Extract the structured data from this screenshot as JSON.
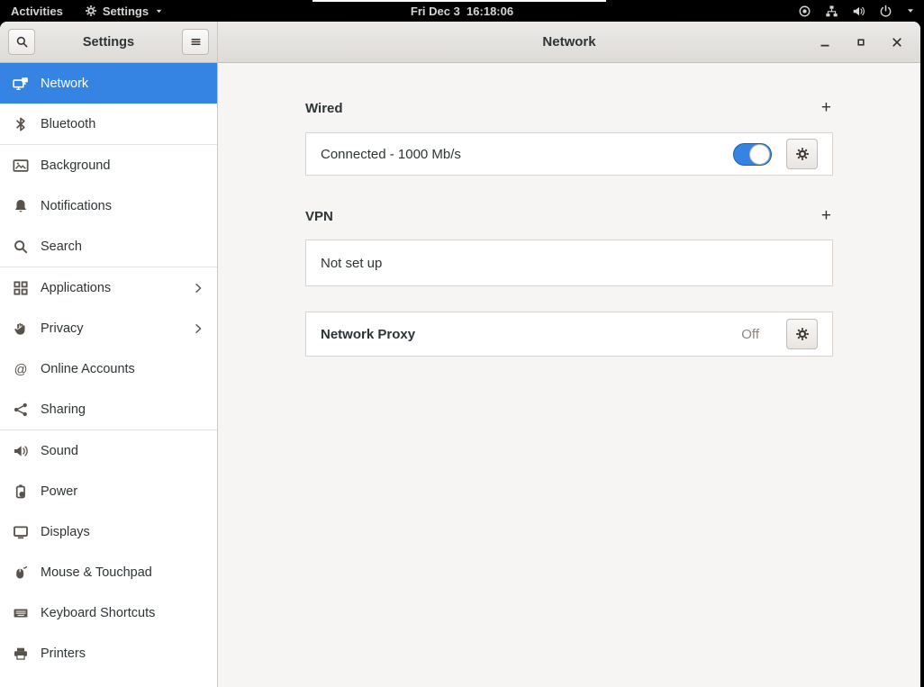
{
  "top_bar": {
    "activities_label": "Activities",
    "app_menu_label": "Settings",
    "clock": "Fri Dec 3  16:18:06"
  },
  "sidebar": {
    "title": "Settings",
    "groups": [
      {
        "items": [
          {
            "label": "Network",
            "icon": "network-icon",
            "selected": true
          },
          {
            "label": "Bluetooth",
            "icon": "bluetooth-icon"
          }
        ]
      },
      {
        "items": [
          {
            "label": "Background",
            "icon": "background-icon"
          },
          {
            "label": "Notifications",
            "icon": "notifications-icon"
          },
          {
            "label": "Search",
            "icon": "search-icon"
          }
        ]
      },
      {
        "items": [
          {
            "label": "Applications",
            "icon": "applications-icon",
            "chevron": true
          },
          {
            "label": "Privacy",
            "icon": "privacy-icon",
            "chevron": true
          },
          {
            "label": "Online Accounts",
            "icon": "online-accounts-icon"
          },
          {
            "label": "Sharing",
            "icon": "sharing-icon"
          }
        ]
      },
      {
        "items": [
          {
            "label": "Sound",
            "icon": "sound-icon"
          },
          {
            "label": "Power",
            "icon": "power-icon"
          },
          {
            "label": "Displays",
            "icon": "displays-icon"
          },
          {
            "label": "Mouse & Touchpad",
            "icon": "mouse-icon"
          },
          {
            "label": "Keyboard Shortcuts",
            "icon": "keyboard-icon"
          },
          {
            "label": "Printers",
            "icon": "printer-icon"
          }
        ]
      }
    ]
  },
  "header": {
    "title": "Network"
  },
  "content": {
    "wired": {
      "title": "Wired",
      "add_label": "+",
      "row_label": "Connected - 1000 Mb/s",
      "toggle_on": true
    },
    "vpn": {
      "title": "VPN",
      "add_label": "+",
      "row_label": "Not set up"
    },
    "proxy": {
      "title": "Network Proxy",
      "status": "Off"
    }
  },
  "colors": {
    "accent": "#3584e4",
    "topbar_bg": "#000000",
    "content_bg": "#f6f5f4",
    "sidebar_bg": "#ffffff",
    "headerbar_bg": "#e4e1de",
    "card_border": "#d8d3ce"
  }
}
